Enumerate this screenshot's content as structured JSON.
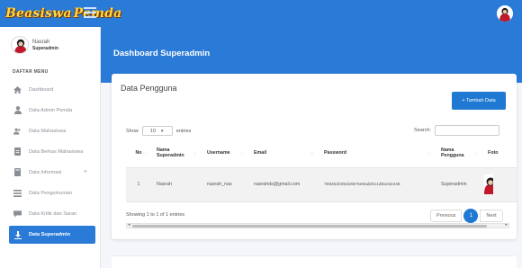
{
  "brand": {
    "logo_part1": "Beasiswa",
    "logo_part2": "Pemda"
  },
  "user": {
    "name": "Nasrah",
    "role": "Superadmin"
  },
  "sidebar": {
    "heading": "DAFTAR MENU",
    "items": [
      {
        "label": "Dashboard",
        "icon": "home-icon"
      },
      {
        "label": "Data Admin Pemda",
        "icon": "user-icon"
      },
      {
        "label": "Data Mahasiswa",
        "icon": "users-icon"
      },
      {
        "label": "Data Berkas Mahasiswa",
        "icon": "file-icon"
      },
      {
        "label": "Data Informasi",
        "icon": "book-icon"
      },
      {
        "label": "Data Pengumuman",
        "icon": "list-icon"
      },
      {
        "label": "Data Kritik dan Saran",
        "icon": "comment-icon"
      },
      {
        "label": "Data Superadmin",
        "icon": "download-icon"
      }
    ]
  },
  "header": {
    "title": "Dashboard Superadmin"
  },
  "card": {
    "title": "Data Pengguna",
    "add_button": "+ Tambah Data",
    "show_label": "Show",
    "entries_value": "10",
    "entries_label": "entries",
    "search_label": "Search:",
    "search_value": "",
    "columns": [
      "No",
      "Nama Superadmin",
      "Username",
      "Email",
      "Password",
      "Nama Pengguna",
      "Foto"
    ],
    "rows": [
      {
        "no": "1",
        "nama": "Nasrah",
        "username": "nasrah_nas",
        "email": "nasrahds@gmail.com",
        "password": "769252035cb6675e9ad25c1d0ac5e446",
        "pengguna": "Superadmin"
      }
    ],
    "info": "Showing 1 to 1 of 1 entries",
    "pagination": {
      "previous": "Previous",
      "current": "1",
      "next": "Next"
    }
  },
  "colors": {
    "primary": "#2a7ad8",
    "button": "#1f78d1",
    "logo_yellow": "#ffd84a"
  }
}
